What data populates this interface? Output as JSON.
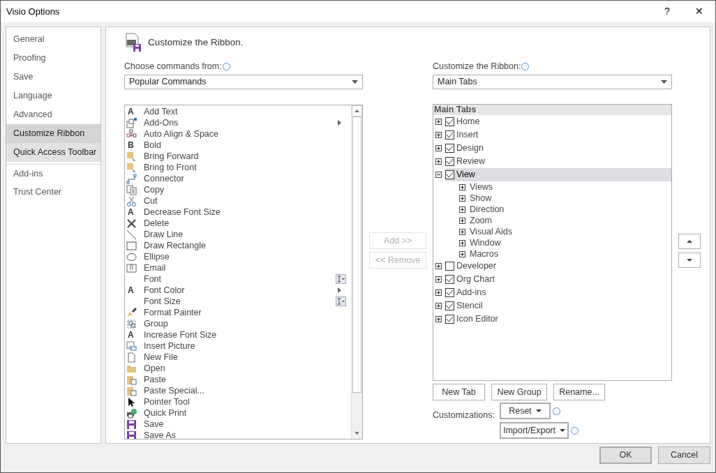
{
  "window": {
    "title": "Visio Options",
    "help": "?",
    "close": "✕"
  },
  "sidebar": {
    "items": [
      {
        "label": "General",
        "selected": false,
        "hovered": false
      },
      {
        "label": "Proofing",
        "selected": false,
        "hovered": false
      },
      {
        "label": "Save",
        "selected": false,
        "hovered": false
      },
      {
        "label": "Language",
        "selected": false,
        "hovered": false
      },
      {
        "label": "Advanced",
        "selected": false,
        "hovered": false
      },
      {
        "label": "Customize Ribbon",
        "selected": true,
        "hovered": false
      },
      {
        "label": "Quick Access Toolbar",
        "selected": false,
        "hovered": true
      },
      {
        "label": "Add-ins",
        "selected": false,
        "hovered": false
      },
      {
        "label": "Trust Center",
        "selected": false,
        "hovered": false
      }
    ]
  },
  "heading": "Customize the Ribbon.",
  "commands_source": {
    "label": "Choose commands from:",
    "value": "Popular Commands"
  },
  "commands": [
    {
      "label": "Add Text",
      "kind": "glyph",
      "glyph": "A",
      "submenu": false,
      "picker": false
    },
    {
      "label": "Add-Ons",
      "kind": "addons",
      "submenu": true,
      "picker": false
    },
    {
      "label": "Auto Align & Space",
      "kind": "align",
      "submenu": false,
      "picker": false
    },
    {
      "label": "Bold",
      "kind": "glyph",
      "glyph": "B",
      "submenu": false,
      "picker": false
    },
    {
      "label": "Bring Forward",
      "kind": "bring",
      "submenu": false,
      "picker": false
    },
    {
      "label": "Bring to Front",
      "kind": "bring",
      "submenu": false,
      "picker": false
    },
    {
      "label": "Connector",
      "kind": "connector",
      "submenu": false,
      "picker": false
    },
    {
      "label": "Copy",
      "kind": "copy",
      "submenu": false,
      "picker": false
    },
    {
      "label": "Cut",
      "kind": "cut",
      "submenu": false,
      "picker": false
    },
    {
      "label": "Decrease Font Size",
      "kind": "glyph",
      "glyph": "A",
      "submenu": false,
      "picker": false
    },
    {
      "label": "Delete",
      "kind": "delete",
      "submenu": false,
      "picker": false
    },
    {
      "label": "Draw Line",
      "kind": "line",
      "submenu": false,
      "picker": false
    },
    {
      "label": "Draw Rectangle",
      "kind": "rect",
      "submenu": false,
      "picker": false
    },
    {
      "label": "Ellipse",
      "kind": "ellipse",
      "submenu": false,
      "picker": false
    },
    {
      "label": "Email",
      "kind": "email",
      "submenu": false,
      "picker": false
    },
    {
      "label": "Font",
      "kind": "none",
      "submenu": false,
      "picker": true
    },
    {
      "label": "Font Color",
      "kind": "glyph",
      "glyph": "A",
      "submenu": true,
      "picker": false
    },
    {
      "label": "Font Size",
      "kind": "none",
      "submenu": false,
      "picker": true
    },
    {
      "label": "Format Painter",
      "kind": "painter",
      "submenu": false,
      "picker": false
    },
    {
      "label": "Group",
      "kind": "group",
      "submenu": false,
      "picker": false
    },
    {
      "label": "Increase Font Size",
      "kind": "glyph",
      "glyph": "A",
      "submenu": false,
      "picker": false
    },
    {
      "label": "Insert Picture",
      "kind": "picture",
      "submenu": false,
      "picker": false
    },
    {
      "label": "New File",
      "kind": "file",
      "submenu": false,
      "picker": false
    },
    {
      "label": "Open",
      "kind": "folder",
      "submenu": false,
      "picker": false
    },
    {
      "label": "Paste",
      "kind": "paste",
      "submenu": false,
      "picker": false
    },
    {
      "label": "Paste Special...",
      "kind": "paste",
      "submenu": false,
      "picker": false
    },
    {
      "label": "Pointer Tool",
      "kind": "pointer",
      "submenu": false,
      "picker": false
    },
    {
      "label": "Quick Print",
      "kind": "print",
      "submenu": false,
      "picker": false
    },
    {
      "label": "Save",
      "kind": "save",
      "submenu": false,
      "picker": false
    },
    {
      "label": "Save As",
      "kind": "save",
      "submenu": false,
      "picker": false
    }
  ],
  "add_button": {
    "label": "Add >>",
    "disabled": true
  },
  "remove_button": {
    "label": "<< Remove",
    "disabled": true
  },
  "ribbon_target": {
    "label": "Customize the Ribbon:",
    "value": "Main Tabs"
  },
  "tree": {
    "header": "Main Tabs",
    "items": [
      {
        "label": "Home",
        "checked": true,
        "expanded": false,
        "selected": false
      },
      {
        "label": "Insert",
        "checked": true,
        "expanded": false,
        "selected": false
      },
      {
        "label": "Design",
        "checked": true,
        "expanded": false,
        "selected": false
      },
      {
        "label": "Review",
        "checked": true,
        "expanded": false,
        "selected": false
      },
      {
        "label": "View",
        "checked": true,
        "expanded": true,
        "selected": true,
        "children": [
          {
            "label": "Views",
            "expanded": false
          },
          {
            "label": "Show",
            "expanded": false
          },
          {
            "label": "Direction",
            "expanded": false
          },
          {
            "label": "Zoom",
            "expanded": false
          },
          {
            "label": "Visual Aids",
            "expanded": false
          },
          {
            "label": "Window",
            "expanded": false
          },
          {
            "label": "Macros",
            "expanded": false
          }
        ]
      },
      {
        "label": "Developer",
        "checked": false,
        "expanded": false,
        "selected": false
      },
      {
        "label": "Org Chart",
        "checked": true,
        "expanded": false,
        "selected": false
      },
      {
        "label": "Add-ins",
        "checked": true,
        "expanded": false,
        "selected": false
      },
      {
        "label": "Stencil",
        "checked": true,
        "expanded": false,
        "selected": false
      },
      {
        "label": "Icon Editor",
        "checked": true,
        "expanded": false,
        "selected": false
      }
    ]
  },
  "tree_buttons": [
    "New Tab",
    "New Group",
    "Rename..."
  ],
  "customizations": {
    "label": "Customizations:",
    "reset": "Reset",
    "import_export": "Import/Export"
  },
  "footer_buttons": [
    "OK",
    "Cancel"
  ]
}
